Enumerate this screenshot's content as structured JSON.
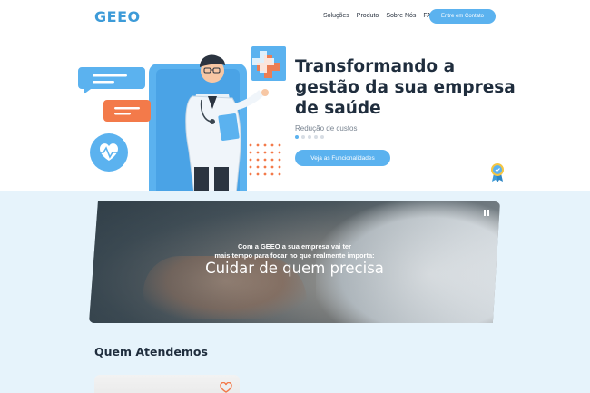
{
  "header": {
    "logo": "GEEO",
    "nav": [
      "Soluções",
      "Produto",
      "Sobre Nós",
      "FAQ"
    ],
    "cta_label": "Entre em Contato"
  },
  "hero": {
    "title": "Transformando a gestão da sua empresa de saúde",
    "subtitle": "Redução de custos",
    "cta_label": "Veja as Funcionalidades",
    "slider_dots": 5,
    "active_dot": 0
  },
  "video": {
    "line1": "Com a GEEO a sua empresa vai ter",
    "line2": "mais tempo para focar no que realmente importa:",
    "main": "Cuidar de quem precisa"
  },
  "section": {
    "title": "Quem Atendemos"
  },
  "colors": {
    "accent": "#5bb2ef",
    "logo": "#3d9bd8",
    "orange": "#f37a4a",
    "section_bg": "#e6f3fb"
  },
  "icons": [
    "heart-icon",
    "pause-icon",
    "award-badge-icon",
    "heartbeat-icon"
  ]
}
